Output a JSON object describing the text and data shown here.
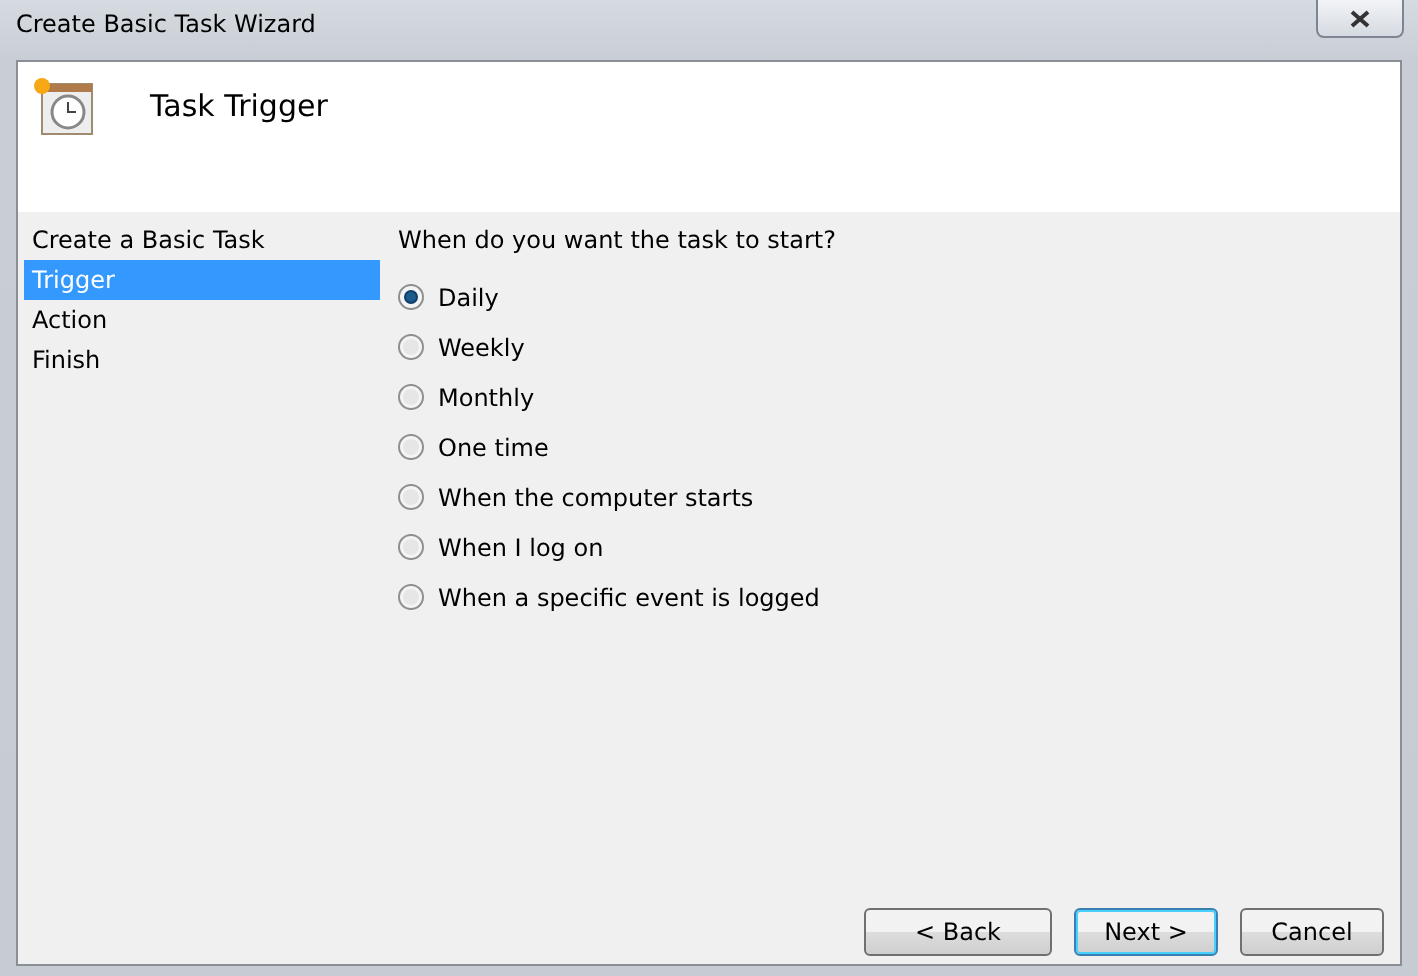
{
  "window": {
    "title": "Create Basic Task Wizard"
  },
  "header": {
    "title": "Task Trigger"
  },
  "sidebar": {
    "items": [
      {
        "label": "Create a Basic Task",
        "selected": false
      },
      {
        "label": "Trigger",
        "selected": true
      },
      {
        "label": "Action",
        "selected": false
      },
      {
        "label": "Finish",
        "selected": false
      }
    ]
  },
  "question": "When do you want the task to start?",
  "options": [
    {
      "label": "Daily",
      "selected": true
    },
    {
      "label": "Weekly",
      "selected": false
    },
    {
      "label": "Monthly",
      "selected": false
    },
    {
      "label": "One time",
      "selected": false
    },
    {
      "label": "When the computer starts",
      "selected": false
    },
    {
      "label": "When I log on",
      "selected": false
    },
    {
      "label": "When a specific event is logged",
      "selected": false
    }
  ],
  "buttons": [
    {
      "label": "< Back",
      "default": false
    },
    {
      "label": "Next >",
      "default": true
    },
    {
      "label": "Cancel",
      "default": false
    }
  ]
}
